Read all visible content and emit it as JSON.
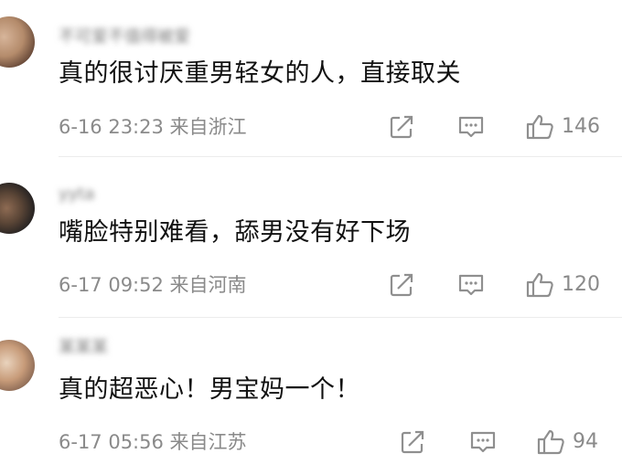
{
  "comments": [
    {
      "username": "不可爱不值得被爱",
      "text": "真的很讨厌重男轻女的人，直接取关",
      "time": "6-16 23:23",
      "location": "来自浙江",
      "likes": "146"
    },
    {
      "username": "yyta",
      "text": "嘴脸特别难看，舔男没有好下场",
      "time": "6-17 09:52",
      "location": "来自河南",
      "likes": "120"
    },
    {
      "username": "某某某",
      "text": "真的超恶心！男宝妈一个！",
      "time": "6-17 05:56",
      "location": "来自江苏",
      "likes": "94"
    }
  ],
  "icons": {
    "repost": "share-edit-icon",
    "comment": "comment-icon",
    "like": "thumbs-up-icon"
  },
  "colors": {
    "text": "#111111",
    "meta": "#8a8a8a",
    "icon": "#8f8f8f",
    "divider": "#ececec"
  }
}
